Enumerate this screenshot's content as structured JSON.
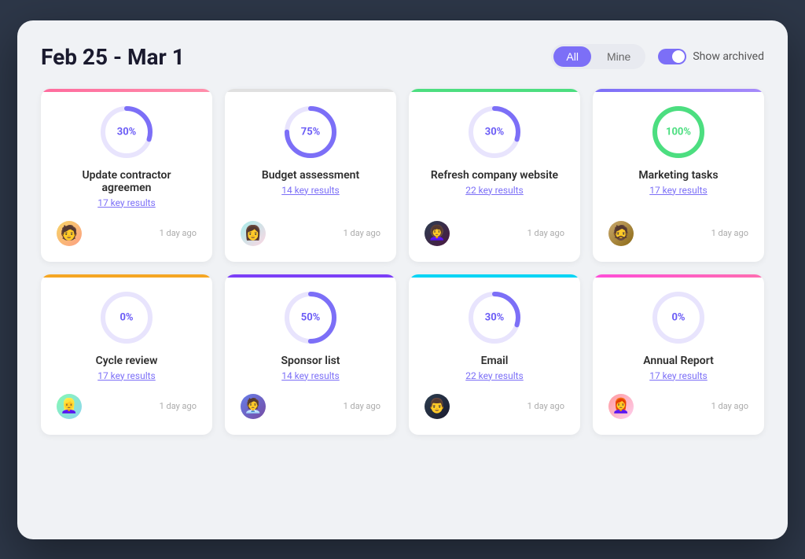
{
  "header": {
    "date_range": "Feb 25 - Mar 1",
    "filter_all": "All",
    "filter_mine": "Mine",
    "show_archived": "Show archived"
  },
  "cards": [
    {
      "id": "card-1",
      "color_class": "pink",
      "progress": 30,
      "progress_label": "30%",
      "title": "Update contractor agreemen",
      "key_results": "17 key results",
      "timestamp": "1 day ago",
      "avatar_class": "av1",
      "avatar_emoji": "👤",
      "stroke_color": "#7c6ff7",
      "track_color": "#e8e4fd",
      "circumference": 188.5,
      "dash_offset": 131.95
    },
    {
      "id": "card-2",
      "color_class": "gray",
      "progress": 75,
      "progress_label": "75%",
      "title": "Budget assessment",
      "key_results": "14 key results",
      "timestamp": "1 day ago",
      "avatar_class": "av2",
      "avatar_emoji": "👤",
      "stroke_color": "#7c6ff7",
      "track_color": "#e8e4fd",
      "circumference": 188.5,
      "dash_offset": 47.125
    },
    {
      "id": "card-3",
      "color_class": "green",
      "progress": 30,
      "progress_label": "30%",
      "title": "Refresh company website",
      "key_results": "22 key results",
      "timestamp": "1 day ago",
      "avatar_class": "av3",
      "avatar_emoji": "👤",
      "stroke_color": "#7c6ff7",
      "track_color": "#e8e4fd",
      "circumference": 188.5,
      "dash_offset": 131.95
    },
    {
      "id": "card-4",
      "color_class": "purple-dark",
      "progress": 100,
      "progress_label": "100%",
      "title": "Marketing tasks",
      "key_results": "17 key results",
      "timestamp": "1 day ago",
      "avatar_class": "av4",
      "avatar_emoji": "👤",
      "stroke_color": "#4cde80",
      "track_color": "#e8fdf0",
      "circumference": 188.5,
      "dash_offset": 0
    },
    {
      "id": "card-5",
      "color_class": "orange",
      "progress": 0,
      "progress_label": "0%",
      "title": "Cycle review",
      "key_results": "17 key results",
      "timestamp": "1 day ago",
      "avatar_class": "av5",
      "avatar_emoji": "👤",
      "stroke_color": "#7c6ff7",
      "track_color": "#e8e4fd",
      "circumference": 188.5,
      "dash_offset": 188.5
    },
    {
      "id": "card-6",
      "color_class": "purple",
      "progress": 50,
      "progress_label": "50%",
      "title": "Sponsor list",
      "key_results": "14 key results",
      "timestamp": "1 day ago",
      "avatar_class": "av6",
      "avatar_emoji": "👤",
      "stroke_color": "#7c6ff7",
      "track_color": "#e8e4fd",
      "circumference": 188.5,
      "dash_offset": 94.25
    },
    {
      "id": "card-7",
      "color_class": "cyan",
      "progress": 30,
      "progress_label": "30%",
      "title": "Email",
      "key_results": "22 key results",
      "timestamp": "1 day ago",
      "avatar_class": "av7",
      "avatar_emoji": "👤",
      "stroke_color": "#7c6ff7",
      "track_color": "#e8e4fd",
      "circumference": 188.5,
      "dash_offset": 131.95
    },
    {
      "id": "card-8",
      "color_class": "magenta",
      "progress": 0,
      "progress_label": "0%",
      "title": "Annual Report",
      "key_results": "17 key results",
      "timestamp": "1 day ago",
      "avatar_class": "av8",
      "avatar_emoji": "👤",
      "stroke_color": "#7c6ff7",
      "track_color": "#e8e4fd",
      "circumference": 188.5,
      "dash_offset": 188.5
    }
  ]
}
